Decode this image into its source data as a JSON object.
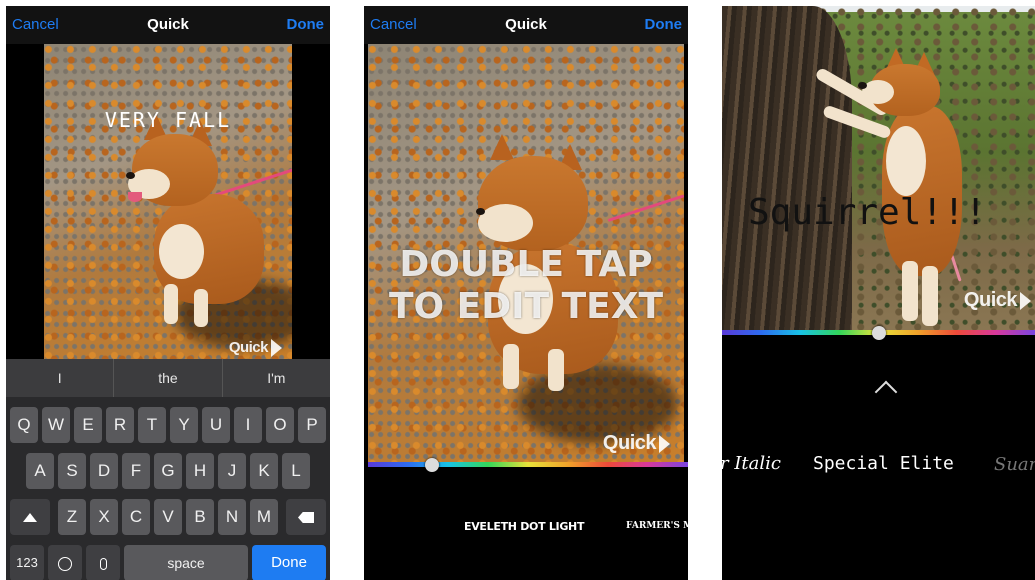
{
  "screen1": {
    "nav": {
      "cancel": "Cancel",
      "title": "Quick",
      "done": "Done"
    },
    "caption": "VERY FALL",
    "watermark": "Quick",
    "suggestions": [
      "I",
      "the",
      "I'm"
    ],
    "keyboard": {
      "row1": [
        "Q",
        "W",
        "E",
        "R",
        "T",
        "Y",
        "U",
        "I",
        "O",
        "P"
      ],
      "row2": [
        "A",
        "S",
        "D",
        "F",
        "G",
        "H",
        "J",
        "K",
        "L"
      ],
      "row3": [
        "Z",
        "X",
        "C",
        "V",
        "B",
        "N",
        "M"
      ],
      "numbers": "123",
      "space": "space",
      "done": "Done"
    }
  },
  "screen2": {
    "nav": {
      "cancel": "Cancel",
      "title": "Quick",
      "done": "Done"
    },
    "caption_line1": "DOUBLE TAP",
    "caption_line2": "TO EDIT TEXT",
    "watermark": "Quick",
    "fonts": [
      "EVELETH DOT LIGHT",
      "FARMER'S MAR"
    ],
    "color_slider_position": 0.2
  },
  "screen3": {
    "caption": "Squirrel!!!",
    "watermark": "Quick",
    "fonts": [
      "r Italic",
      "Special Elite",
      "Suar"
    ],
    "color_slider_position": 0.5
  },
  "colors": {
    "accent": "#1e7cf2",
    "background": "#000000",
    "leash": "#e34a7c"
  }
}
